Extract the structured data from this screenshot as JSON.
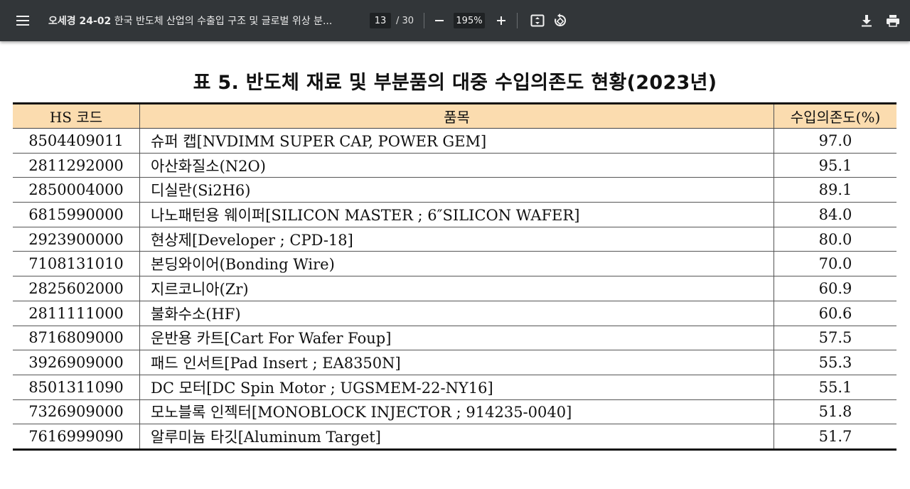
{
  "toolbar": {
    "title_bold": "오세경 24-02",
    "title_rest": " 한국 반도체 산업의 수출입 구조 및 글로벌 위상 분...",
    "page_current": "13",
    "page_total": "/ 30",
    "zoom": "195%",
    "icons": [
      "menu-icon",
      "zoom-out-icon",
      "zoom-in-icon",
      "fit-page-icon",
      "rotate-icon",
      "download-icon",
      "print-icon"
    ]
  },
  "document": {
    "table_title": "표 5. 반도체 재료 및 부분품의 대중 수입의존도 현황(2023년)",
    "headers": [
      "HS 코드",
      "품목",
      "수입의존도(%)"
    ],
    "rows": [
      {
        "code": "8504409011",
        "item": "슈퍼 캡[NVDIMM SUPER CAP, POWER GEM]",
        "dep": "97.0"
      },
      {
        "code": "2811292000",
        "item": "아산화질소(N2O)",
        "dep": "95.1"
      },
      {
        "code": "2850004000",
        "item": "디실란(Si2H6)",
        "dep": "89.1"
      },
      {
        "code": "6815990000",
        "item": "나노패턴용 웨이퍼[SILICON MASTER ; 6″SILICON WAFER]",
        "dep": "84.0"
      },
      {
        "code": "2923900000",
        "item": "현상제[Developer ; CPD-18]",
        "dep": "80.0"
      },
      {
        "code": "7108131010",
        "item": "본딩와이어(Bonding Wire)",
        "dep": "70.0"
      },
      {
        "code": "2825602000",
        "item": "지르코니아(Zr)",
        "dep": "60.9"
      },
      {
        "code": "2811111000",
        "item": "불화수소(HF)",
        "dep": "60.6"
      },
      {
        "code": "8716809000",
        "item": "운반용 카트[Cart For Wafer Foup]",
        "dep": "57.5"
      },
      {
        "code": "3926909000",
        "item": "패드 인서트[Pad Insert ; EA8350N]",
        "dep": "55.3"
      },
      {
        "code": "8501311090",
        "item": "DC 모터[DC Spin Motor ; UGSMEM-22-NY16]",
        "dep": "55.1"
      },
      {
        "code": "7326909000",
        "item": "모노블록 인젝터[MONOBLOCK INJECTOR ; 914235-0040]",
        "dep": "51.8"
      },
      {
        "code": "7616999090",
        "item": "알루미늄 타깃[Aluminum Target]",
        "dep": "51.7"
      }
    ]
  }
}
